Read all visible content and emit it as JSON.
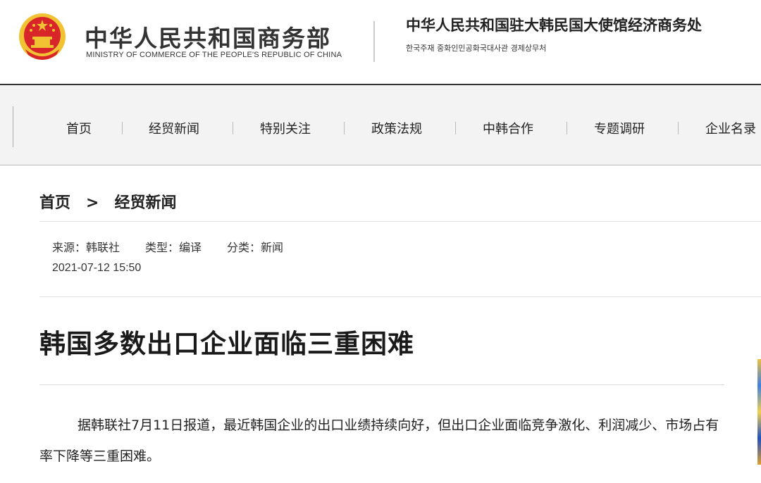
{
  "header": {
    "emblem_icon": "national-emblem-icon",
    "ministry_cn": "中华人民共和国商务部",
    "ministry_en": "MINISTRY OF COMMERCE OF THE PEOPLE'S REPUBLIC OF CHINA",
    "embassy_cn": "中华人民共和国驻大韩民国大使馆经济商务处",
    "embassy_kr": "한국주재 중화인민공화국대사관 경제상무처"
  },
  "nav": {
    "items": [
      "首页",
      "经贸新闻",
      "特别关注",
      "政策法规",
      "中韩合作",
      "专题调研",
      "企业名录"
    ]
  },
  "breadcrumb": {
    "home": "首页",
    "separator": ">",
    "current": "经贸新闻"
  },
  "article": {
    "source": "来源：韩联社",
    "type": "类型：编译",
    "category": "分类：新闻",
    "datetime": "2021-07-12 15:50",
    "title": "韩国多数出口企业面临三重困难",
    "paragraph": "据韩联社7月11日报道，最近韩国企业的出口业绩持续向好，但出口企业面临竞争激化、利润减少、市场占有率下降等三重困难。"
  },
  "colors": {
    "emblem_red": "#d8252a",
    "emblem_gold": "#f1c232",
    "nav_bg": "#f3f3f3"
  }
}
